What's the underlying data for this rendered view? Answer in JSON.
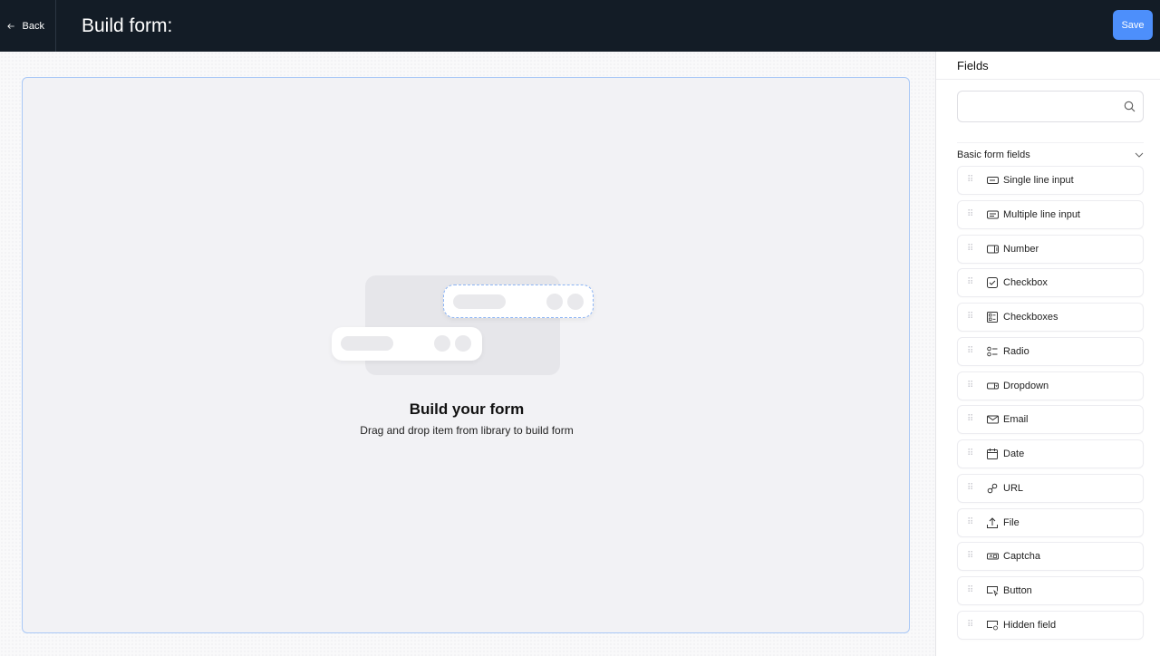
{
  "header": {
    "back_label": "Back",
    "title": "Build form:",
    "save_label": "Save"
  },
  "canvas": {
    "empty_title": "Build your form",
    "empty_subtitle": "Drag and drop item from library to build form"
  },
  "panel": {
    "title": "Fields",
    "search_placeholder": "",
    "search_value": "",
    "section_title": "Basic form fields",
    "fields": [
      {
        "label": "Single line input",
        "icon": "single-line-input-icon"
      },
      {
        "label": "Multiple line input",
        "icon": "multiple-line-input-icon"
      },
      {
        "label": "Number",
        "icon": "number-icon"
      },
      {
        "label": "Checkbox",
        "icon": "checkbox-icon"
      },
      {
        "label": "Checkboxes",
        "icon": "checkboxes-icon"
      },
      {
        "label": "Radio",
        "icon": "radio-icon"
      },
      {
        "label": "Dropdown",
        "icon": "dropdown-icon"
      },
      {
        "label": "Email",
        "icon": "email-icon"
      },
      {
        "label": "Date",
        "icon": "calendar-icon"
      },
      {
        "label": "URL",
        "icon": "link-icon"
      },
      {
        "label": "File",
        "icon": "upload-icon"
      },
      {
        "label": "Captcha",
        "icon": "captcha-icon"
      },
      {
        "label": "Button",
        "icon": "button-icon"
      },
      {
        "label": "Hidden field",
        "icon": "hidden-field-icon"
      }
    ]
  },
  "colors": {
    "topbar": "#131c26",
    "accent": "#4d8ffb",
    "dropzone_border": "#a9c8f6"
  }
}
